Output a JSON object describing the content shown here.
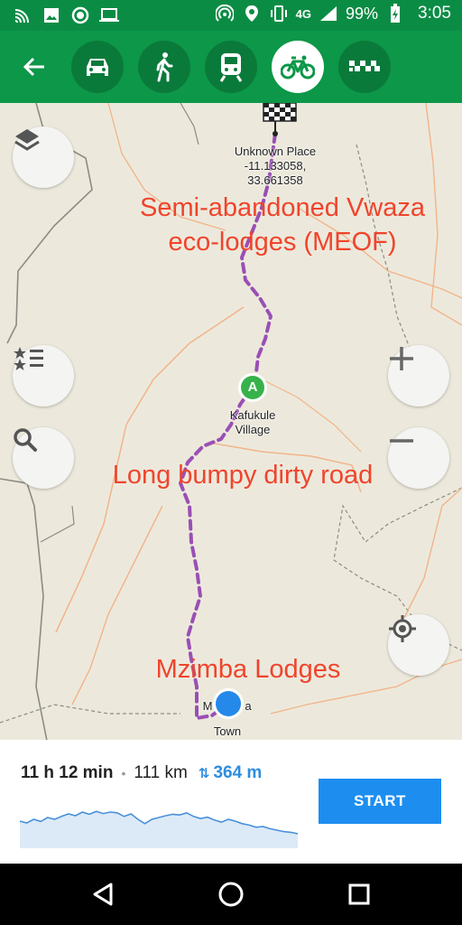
{
  "status_bar": {
    "network": "4G",
    "battery": "99%",
    "time": "3:05",
    "left_icons": [
      "cast-icon",
      "image-icon",
      "circle-notification-icon",
      "laptop-icon"
    ],
    "right_icons": [
      "hotspot-icon",
      "location-icon",
      "vibrate-icon",
      "signal-icon",
      "battery-charging-icon"
    ]
  },
  "toolbar": {
    "back_icon": "arrow-left-icon",
    "modes": [
      {
        "name": "car",
        "icon": "car-icon",
        "active": false
      },
      {
        "name": "walk",
        "icon": "pedestrian-icon",
        "active": false
      },
      {
        "name": "transit",
        "icon": "train-icon",
        "active": false
      },
      {
        "name": "bicycle",
        "icon": "bicycle-icon",
        "active": true
      },
      {
        "name": "taxi",
        "icon": "taxi-icon",
        "active": false
      }
    ],
    "accent": "#0d9748"
  },
  "map": {
    "route_color": "#9a4fb5",
    "destination": {
      "name": "Unknown Place",
      "coords": "-11.133058, 33.661358",
      "coords_line1": "-11.133058,",
      "coords_line2": "33.661358"
    },
    "waypoint": {
      "letter": "A",
      "name_line1": "Kafukule",
      "name_line2": "Village"
    },
    "origin": {
      "label_partial": "M",
      "label_partial_end": "a",
      "sub_label": "Town"
    },
    "annotations": {
      "top_line1": "Semi-abandoned Vwaza",
      "top_line2": "eco-lodges (MEOF)",
      "middle": "Long bumpy dirty road",
      "bottom": "Mzimba Lodges"
    },
    "annotation_color": "#f0442c",
    "buttons": [
      "layers-icon",
      "bookmarks-icon",
      "search-icon",
      "zoom-in-icon",
      "zoom-out-icon",
      "my-location-icon"
    ]
  },
  "route_panel": {
    "duration": "11 h 12 min",
    "separator": "•",
    "distance": "111 km",
    "climb": "364 m",
    "start_label": "START",
    "elevation_profile": [
      0.55,
      0.6,
      0.5,
      0.56,
      0.45,
      0.5,
      0.42,
      0.35,
      0.4,
      0.3,
      0.36,
      0.28,
      0.34,
      0.3,
      0.32,
      0.42,
      0.35,
      0.5,
      0.62,
      0.5,
      0.45,
      0.4,
      0.36,
      0.38,
      0.32,
      0.42,
      0.48,
      0.44,
      0.52,
      0.58,
      0.5,
      0.55,
      0.62,
      0.66,
      0.72,
      0.7,
      0.76,
      0.8,
      0.84,
      0.86,
      0.9
    ]
  },
  "nav_bar": {
    "back": "back-triangle-icon",
    "home": "home-circle-icon",
    "recents": "recents-square-icon"
  }
}
